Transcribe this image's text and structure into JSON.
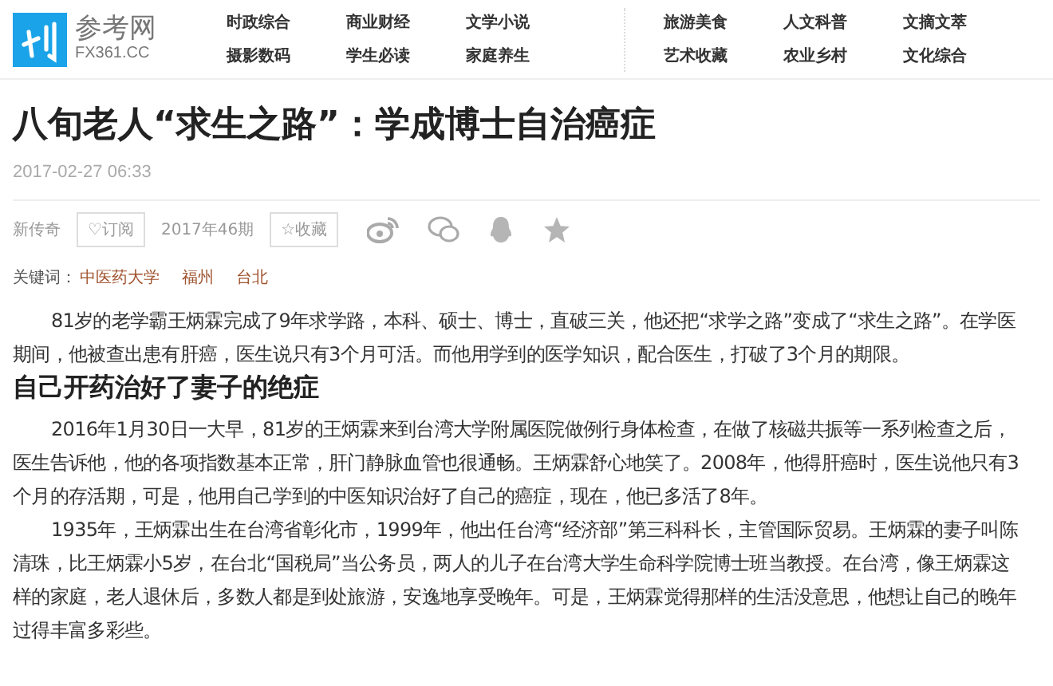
{
  "header": {
    "site_name": "参考网",
    "site_domain": "FX361.CC",
    "nav_groups": [
      [
        "时政综合",
        "商业财经",
        "文学小说",
        "摄影数码",
        "学生必读",
        "家庭养生"
      ],
      [
        "旅游美食",
        "人文科普",
        "文摘文萃",
        "艺术收藏",
        "农业乡村",
        "文化综合"
      ]
    ]
  },
  "article": {
    "title": "八旬老人“求生之路”：学成博士自治癌症",
    "date": "2017-02-27 06:33",
    "toolbar": [
      {
        "kind": "text",
        "label": "新传奇"
      },
      {
        "kind": "button",
        "label": "♡订阅"
      },
      {
        "kind": "text",
        "label": "2017年46期"
      },
      {
        "kind": "button",
        "label": "☆收藏"
      },
      {
        "kind": "weibo"
      },
      {
        "kind": "wechat"
      },
      {
        "kind": "qq"
      },
      {
        "kind": "star"
      }
    ],
    "keywords_label": "关键词：",
    "keywords": [
      "中医药大学",
      "福州",
      "台北"
    ],
    "body": [
      {
        "kind": "paragraph",
        "text": "81岁的老学霸王炳霖完成了9年求学路，本科、硕士、博士，直破三关，他还把“求学之路”变成了“求生之路”。在学医期间，他被查出患有肝癌，医生说只有3个月可活。而他用学到的医学知识，配合医生，打破了3个月的期限。"
      },
      {
        "kind": "heading",
        "text": "自己开药治好了妻子的绝症"
      },
      {
        "kind": "paragraph",
        "text": "2016年1月30日一大早，81岁的王炳霖来到台湾大学附属医院做例行身体检查，在做了核磁共振等一系列检查之后，医生告诉他，他的各项指数基本正常，肝门静脉血管也很通畅。王炳霖舒心地笑了。2008年，他得肝癌时，医生说他只有3个月的存活期，可是，他用自己学到的中医知识治好了自己的癌症，现在，他已多活了8年。"
      },
      {
        "kind": "paragraph",
        "text": "1935年，王炳霖出生在台湾省彰化市，1999年，他出任台湾“经济部”第三科科长，主管国际贸易。王炳霖的妻子叫陈清珠，比王炳霖小5岁，在台北“国税局”当公务员，两人的儿子在台湾大学生命科学院博士班当教授。在台湾，像王炳霖这样的家庭，老人退休后，多数人都是到处旅游，安逸地享受晚年。可是，王炳霖觉得那样的生活没意思，他想让自己的晚年过得丰富多彩些。"
      }
    ]
  }
}
